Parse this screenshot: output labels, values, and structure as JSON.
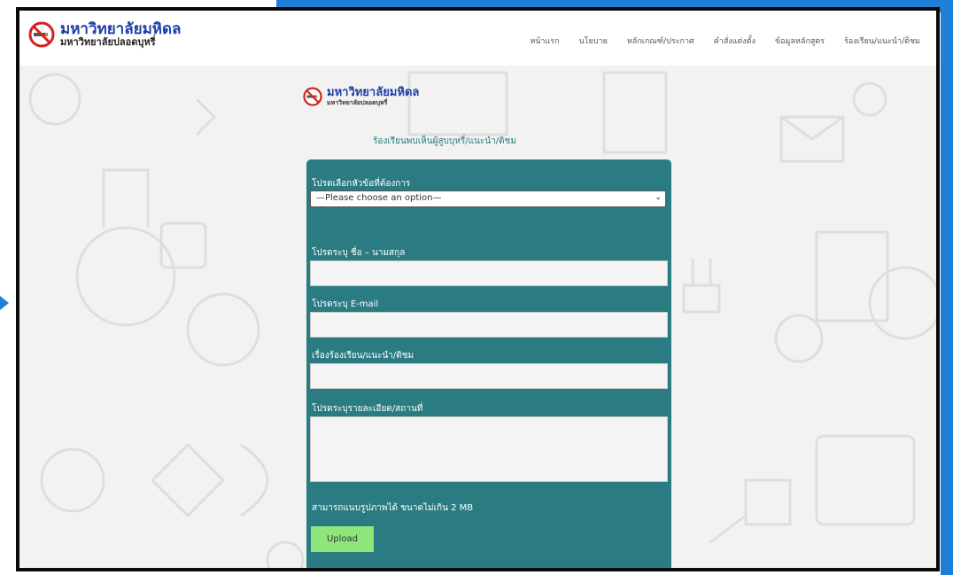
{
  "brand": {
    "name": "มหาวิทยาลัยมหิดล",
    "subtitle": "มหาวิทยาลัยปลอดบุหรี่"
  },
  "nav": {
    "items": [
      "หน้าแรก",
      "นโยบาย",
      "หลักเกณฑ์/ประกาศ",
      "คำสั่งแต่งตั้ง",
      "ข้อมูลหลักสูตร",
      "ร้องเรียน/แนะนำ/ติชม"
    ]
  },
  "page": {
    "heading": "ร้องเรียนพบเห็นผู้สูบบุหรี่/แนะนำ/ติชม"
  },
  "form": {
    "topic_label": "โปรดเลือกหัวข้อที่ต้องการ",
    "topic_value": "—Please choose an option—",
    "name_label": "โปรดระบุ ชื่อ – นามสกุล",
    "email_label": "โปรดระบุ E-mail",
    "subject_label": "เรื่องร้องเรียน/แนะนำ/ติชม",
    "details_label": "โปรดระบุรายละเอียด/สถานที่",
    "attach_note": "สามารถแนบรูปภาพได้ ขนาดไม่เกิน 2 MB",
    "upload_label": "Upload"
  },
  "colors": {
    "accent_frame": "#1f7fd6",
    "panel": "#2b7c82",
    "upload_button": "#8ee57a",
    "brand_text": "#1d3fa6"
  },
  "icons": [
    "no-smoking-icon",
    "chevron-down-icon"
  ]
}
